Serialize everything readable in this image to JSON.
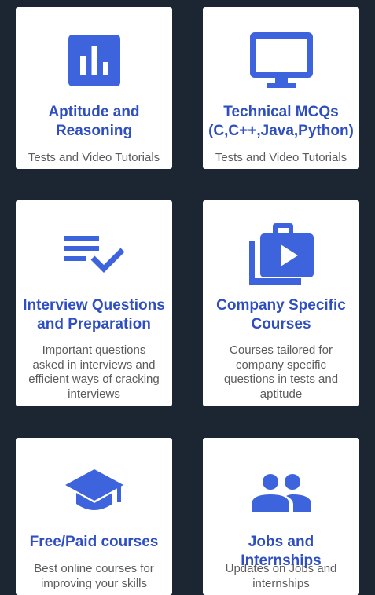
{
  "accent_color": "#3d63dd",
  "title_color": "#2f4fc0",
  "cards": [
    {
      "icon": "bar-chart-icon",
      "title": "Aptitude and\nReasoning",
      "description": "Tests and Video Tutorials"
    },
    {
      "icon": "monitor-icon",
      "title": "Technical MCQs\n(C,C++,Java,Python)",
      "description": "Tests and Video Tutorials"
    },
    {
      "icon": "list-check-icon",
      "title": "Interview Questions\nand Preparation",
      "description": "Important questions\nasked in interviews and\nefficient ways of cracking\ninterviews"
    },
    {
      "icon": "briefcase-play-icon",
      "title": "Company Specific\nCourses",
      "description": "Courses tailored for\ncompany specific\nquestions in tests and\naptitude"
    },
    {
      "icon": "graduation-cap-icon",
      "title": "Free/Paid courses",
      "description": "Best online courses for\nimproving your skills"
    },
    {
      "icon": "people-icon",
      "title": "Jobs and Internships",
      "description": "Updates on Jobs and\ninternships"
    }
  ]
}
